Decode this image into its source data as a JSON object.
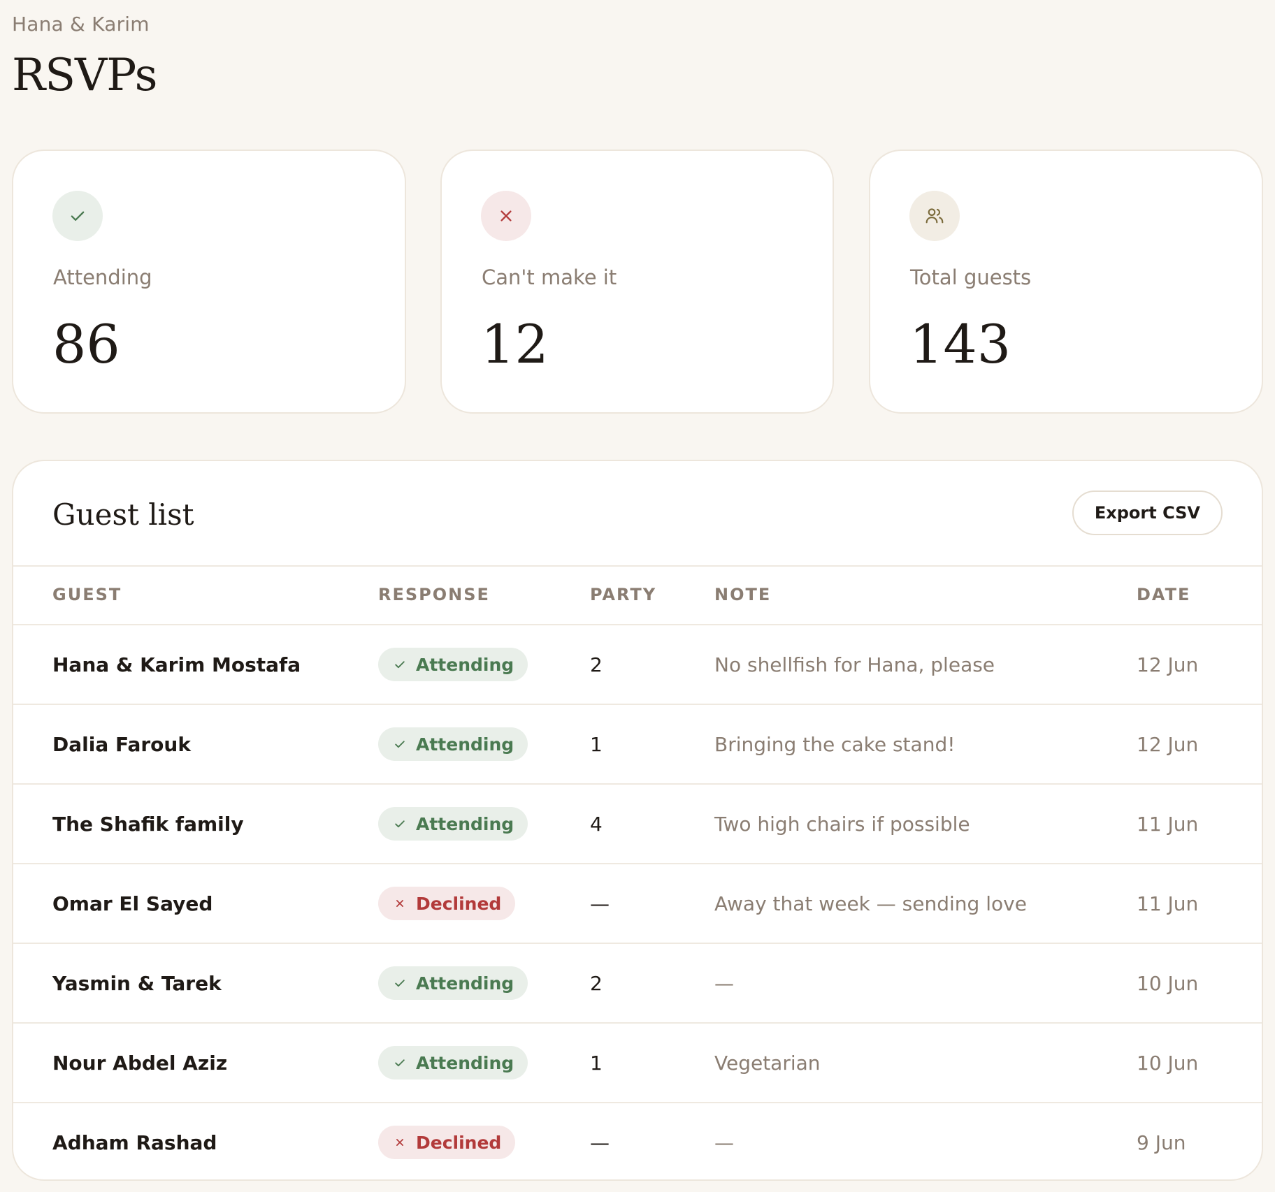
{
  "header": {
    "couple": "Hana & Karim",
    "title": "RSVPs"
  },
  "stats": [
    {
      "label": "Attending",
      "value": "86",
      "icon": "check-icon"
    },
    {
      "label": "Can't make it",
      "value": "12",
      "icon": "close-icon"
    },
    {
      "label": "Total guests",
      "value": "143",
      "icon": "people-icon"
    }
  ],
  "guest_list": {
    "title": "Guest list",
    "export_label": "Export CSV",
    "columns": {
      "guest": "GUEST",
      "response": "RESPONSE",
      "party": "PARTY",
      "note": "NOTE",
      "date": "DATE"
    },
    "rows": [
      {
        "guest": "Hana & Karim Mostafa",
        "response": "Attending",
        "party": "2",
        "note": "No shellfish for Hana, please",
        "date": "12 Jun"
      },
      {
        "guest": "Dalia Farouk",
        "response": "Attending",
        "party": "1",
        "note": "Bringing the cake stand!",
        "date": "12 Jun"
      },
      {
        "guest": "The Shafik family",
        "response": "Attending",
        "party": "4",
        "note": "Two high chairs if possible",
        "date": "11 Jun"
      },
      {
        "guest": "Omar El Sayed",
        "response": "Declined",
        "party": "—",
        "note": "Away that week — sending love",
        "date": "11 Jun"
      },
      {
        "guest": "Yasmin & Tarek",
        "response": "Attending",
        "party": "2",
        "note": "—",
        "date": "10 Jun"
      },
      {
        "guest": "Nour Abdel Aziz",
        "response": "Attending",
        "party": "1",
        "note": "Vegetarian",
        "date": "10 Jun"
      },
      {
        "guest": "Adham Rashad",
        "response": "Declined",
        "party": "—",
        "note": "—",
        "date": "9 Jun"
      }
    ]
  },
  "colors": {
    "background": "#f9f6f1",
    "attending": "#4a7a51",
    "declined": "#b23a3a",
    "muted_text": "#8a7d72"
  }
}
